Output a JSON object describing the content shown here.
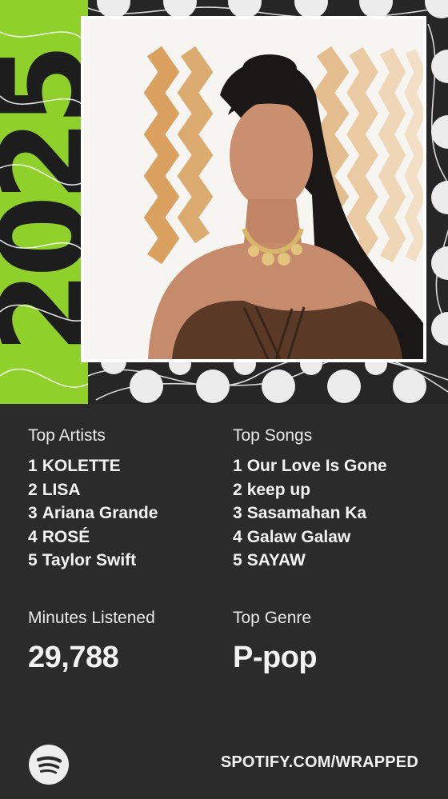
{
  "wrapped": {
    "year": "2025",
    "colors": {
      "accent": "#8fd12a",
      "background": "#2b2b2b",
      "dots": "#ececec"
    },
    "top_artists": {
      "label": "Top Artists",
      "items": [
        {
          "rank": "1",
          "name": "KOLETTE"
        },
        {
          "rank": "2",
          "name": "LISA"
        },
        {
          "rank": "3",
          "name": "Ariana Grande"
        },
        {
          "rank": "4",
          "name": "ROSÉ"
        },
        {
          "rank": "5",
          "name": "Taylor Swift"
        }
      ]
    },
    "top_songs": {
      "label": "Top Songs",
      "items": [
        {
          "rank": "1",
          "name": "Our Love Is Gone"
        },
        {
          "rank": "2",
          "name": "keep up"
        },
        {
          "rank": "3",
          "name": "Sasamahan Ka"
        },
        {
          "rank": "4",
          "name": "Galaw Galaw"
        },
        {
          "rank": "5",
          "name": "SAYAW"
        }
      ]
    },
    "minutes": {
      "label": "Minutes Listened",
      "value": "29,788"
    },
    "genre": {
      "label": "Top Genre",
      "value": "P-pop"
    },
    "footer": {
      "logo_icon": "spotify-icon",
      "url": "SPOTIFY.COM/WRAPPED"
    }
  }
}
